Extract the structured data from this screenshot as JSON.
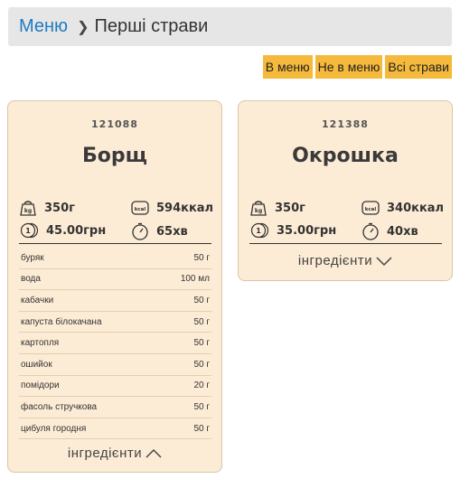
{
  "breadcrumb": {
    "root": "Меню",
    "current": "Перші страви"
  },
  "filters": [
    "В меню",
    "Не в меню",
    "Всі страви"
  ],
  "dishes": [
    {
      "code": "121088",
      "name": "Борщ",
      "weight": "350г",
      "calories": "594ккал",
      "price": "45.00грн",
      "time": "65хв",
      "ingredients": [
        {
          "name": "буряк",
          "qty": "50 г"
        },
        {
          "name": "вода",
          "qty": "100 мл"
        },
        {
          "name": "кабачки",
          "qty": "50 г"
        },
        {
          "name": "капуста білокачана",
          "qty": "50 г"
        },
        {
          "name": "картопля",
          "qty": "50 г"
        },
        {
          "name": "ошийок",
          "qty": "50 г"
        },
        {
          "name": "помідори",
          "qty": "20 г"
        },
        {
          "name": "фасоль стручкова",
          "qty": "50 г"
        },
        {
          "name": "цибуля городня",
          "qty": "50 г"
        }
      ],
      "ingredients_toggle": "інгредієнти",
      "expanded": true
    },
    {
      "code": "121388",
      "name": "Окрошка",
      "weight": "350г",
      "calories": "340ккал",
      "price": "35.00грн",
      "time": "40хв",
      "ingredients_toggle": "інгредієнти",
      "expanded": false
    }
  ],
  "icons": {
    "weight": "kg-weight-icon",
    "calories": "kcal-icon",
    "price": "coins-icon",
    "time": "timer-icon",
    "expand": "chevron-down-icon",
    "collapse": "chevron-up-icon"
  },
  "colors": {
    "link": "#1f7cc1",
    "filter_button": "#f5b93b",
    "card_bg": "#fdecd5"
  }
}
